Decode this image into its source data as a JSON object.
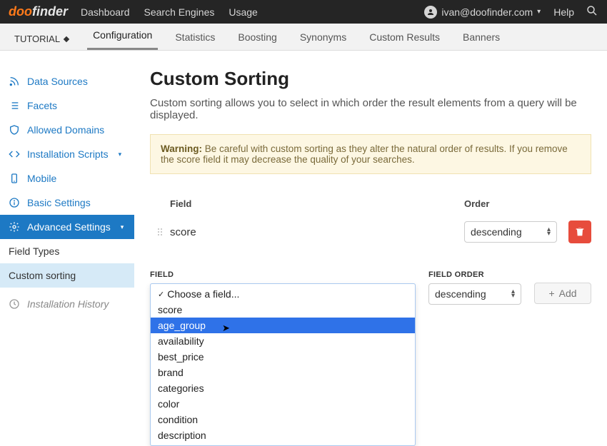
{
  "header": {
    "brand_a": "doo",
    "brand_b": "finder",
    "links": [
      "Dashboard",
      "Search Engines",
      "Usage"
    ],
    "user_email": "ivan@doofinder.com",
    "help": "Help"
  },
  "subnav": {
    "engine": "TUTORIAL",
    "tabs": [
      "Configuration",
      "Statistics",
      "Boosting",
      "Synonyms",
      "Custom Results",
      "Banners"
    ],
    "active": 0
  },
  "sidebar": {
    "items": [
      {
        "icon": "rss",
        "label": "Data Sources"
      },
      {
        "icon": "list",
        "label": "Facets"
      },
      {
        "icon": "shield",
        "label": "Allowed Domains"
      },
      {
        "icon": "code",
        "label": "Installation Scripts",
        "caret": true
      },
      {
        "icon": "mobile",
        "label": "Mobile"
      },
      {
        "icon": "info",
        "label": "Basic Settings"
      },
      {
        "icon": "gear",
        "label": "Advanced Settings",
        "caret": true,
        "active": true
      }
    ],
    "subs": [
      {
        "label": "Field Types"
      },
      {
        "label": "Custom sorting",
        "active": true
      }
    ],
    "history": {
      "icon": "clock",
      "label": "Installation History"
    }
  },
  "page": {
    "title": "Custom Sorting",
    "intro": "Custom sorting allows you to select in which order the result elements from a query will be displayed.",
    "warning_label": "Warning:",
    "warning_text": " Be careful with custom sorting as they alter the natural order of results. If you remove the score field it may decrease the quality of your searches."
  },
  "table": {
    "col_field": "Field",
    "col_order": "Order",
    "rows": [
      {
        "field": "score",
        "order": "descending"
      }
    ]
  },
  "new_row": {
    "field_label": "FIELD",
    "order_label": "FIELD ORDER",
    "order_value": "descending",
    "add_label": "Add",
    "dropdown": {
      "placeholder": "Choose a field...",
      "options": [
        "score",
        "age_group",
        "availability",
        "best_price",
        "brand",
        "categories",
        "color",
        "condition",
        "description"
      ],
      "highlighted": 1
    }
  }
}
